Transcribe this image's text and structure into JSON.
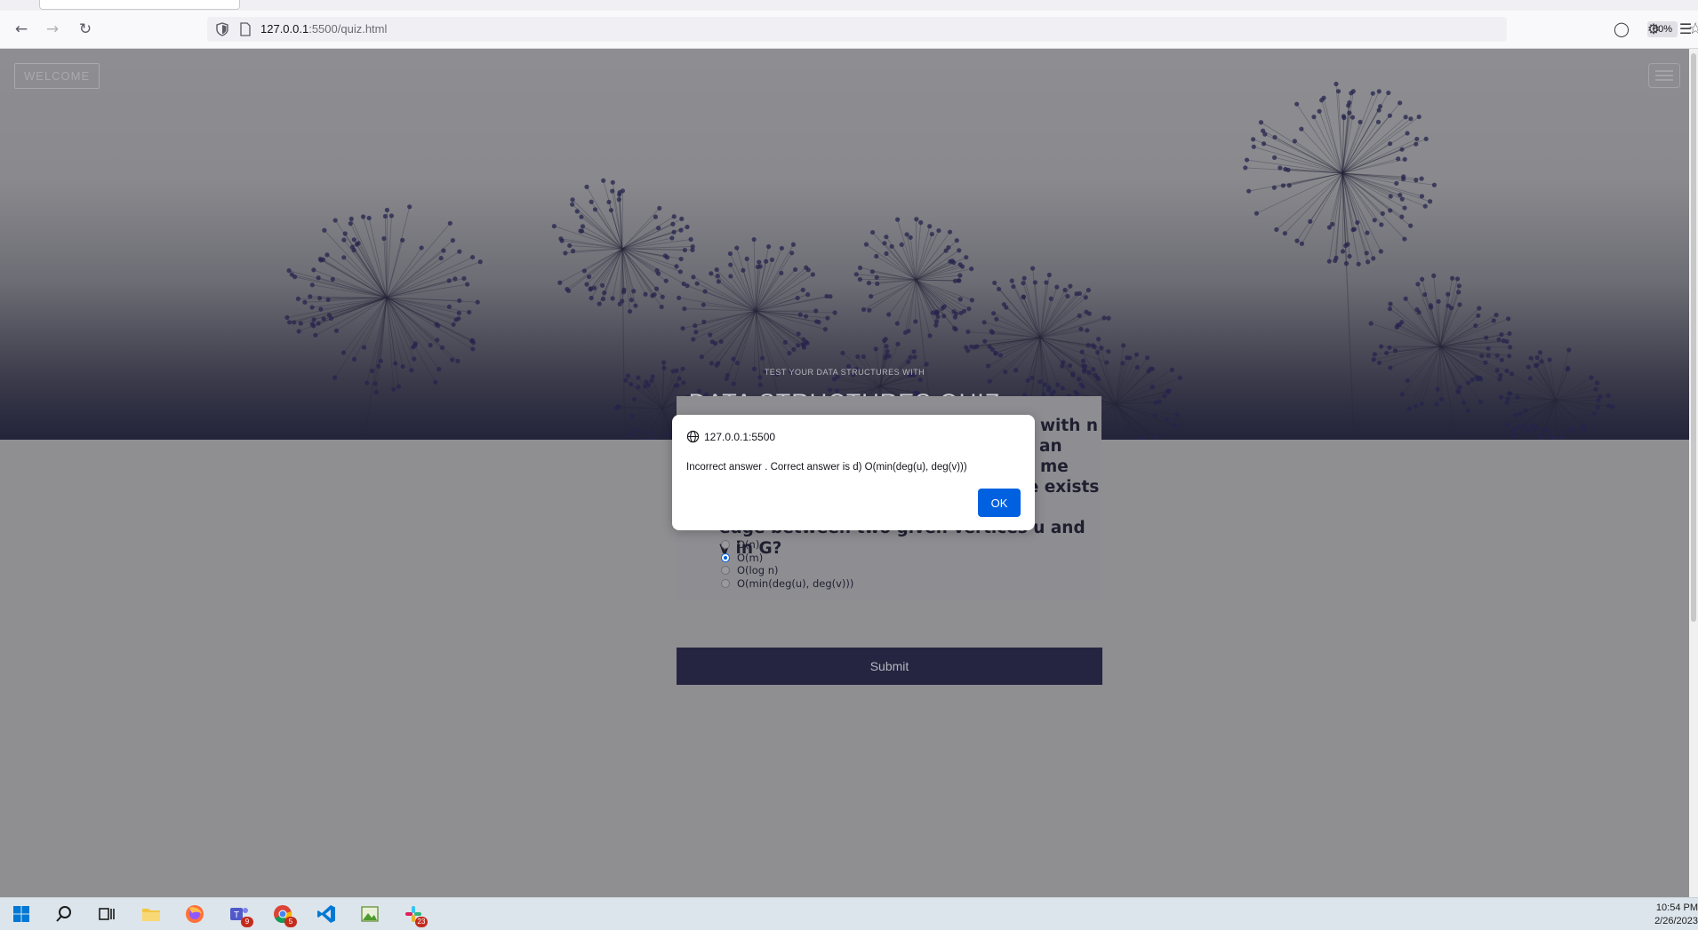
{
  "browser": {
    "url_host": "127.0.0.1",
    "url_path": ":5500/quiz.html",
    "zoom": "80%"
  },
  "page": {
    "welcome_label": "WELCOME",
    "hero_subtitle": "TEST YOUR DATA STRUCTURES WITH",
    "hero_title": "DATA STRUCTURES QUIZ",
    "question_visible_lines": [
      "G with n",
      "an",
      "me",
      "complexity of determining if there exists an",
      "edge between two given vertices u and v in G?"
    ],
    "options": [
      {
        "label": "O(n)",
        "checked": false
      },
      {
        "label": "O(m)",
        "checked": true
      },
      {
        "label": "O(log n)",
        "checked": false
      },
      {
        "label": "O(min(deg(u), deg(v)))",
        "checked": false
      }
    ],
    "submit_label": "Submit"
  },
  "dialog": {
    "origin": "127.0.0.1:5500",
    "message": "Incorrect answer . Correct answer is d) O(min(deg(u), deg(v)))",
    "ok_label": "OK"
  },
  "taskbar": {
    "badges": {
      "teams": "9",
      "chrome": "5",
      "slack": "23"
    },
    "time": "10:54 PM",
    "date": "2/26/2023"
  },
  "colors": {
    "accent": "#0061e0",
    "submit_bg": "#252541"
  }
}
